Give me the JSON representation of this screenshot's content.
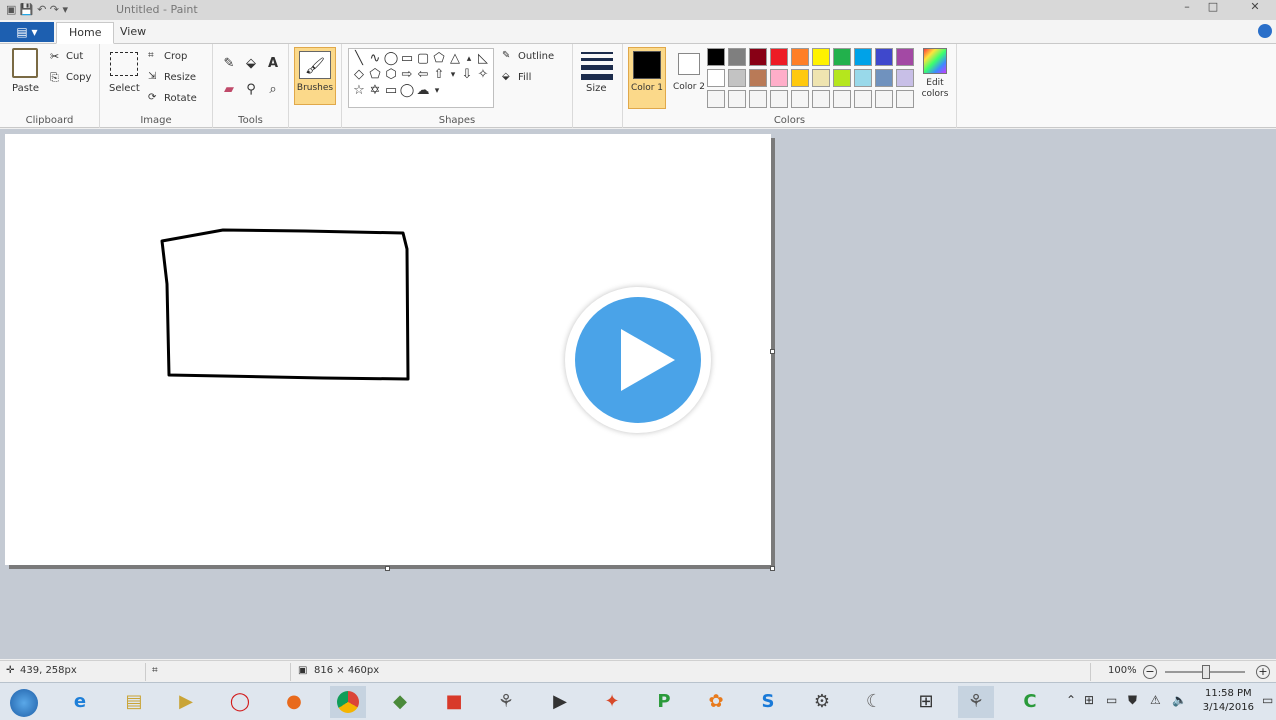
{
  "window": {
    "title": "Untitled - Paint",
    "controls": [
      "–",
      "□",
      "✕"
    ]
  },
  "tabs": {
    "file_label": "▤ ▾",
    "home": "Home",
    "view": "View"
  },
  "ribbon": {
    "clipboard": {
      "label": "Clipboard",
      "paste": "Paste",
      "cut": "Cut",
      "copy": "Copy"
    },
    "image": {
      "label": "Image",
      "select": "Select",
      "crop": "Crop",
      "resize": "Resize",
      "rotate": "Rotate"
    },
    "tools": {
      "label": "Tools"
    },
    "brushes": {
      "label": "Brushes"
    },
    "shapes": {
      "label": "Shapes",
      "outline": "Outline",
      "fill": "Fill"
    },
    "size": {
      "label": "Size"
    },
    "colors": {
      "label": "Colors",
      "color1": "Color 1",
      "color2": "Color 2",
      "edit": "Edit colors",
      "row1": [
        "#000000",
        "#7f7f7f",
        "#880015",
        "#ed1c24",
        "#ff7f27",
        "#fff200",
        "#22b14c",
        "#00a2e8",
        "#3f48cc",
        "#a349a4"
      ],
      "row2": [
        "#ffffff",
        "#c3c3c3",
        "#b97a57",
        "#ffaec9",
        "#ffc90e",
        "#efe4b0",
        "#b5e61d",
        "#99d9ea",
        "#7092be",
        "#c8bfe7"
      ],
      "row3": [
        "#f5f5f5",
        "#f5f5f5",
        "#f5f5f5",
        "#f5f5f5",
        "#f5f5f5",
        "#f5f5f5",
        "#f5f5f5",
        "#f5f5f5",
        "#f5f5f5",
        "#f5f5f5"
      ]
    }
  },
  "status": {
    "cursor": "439, 258px",
    "canvas_size": "816 × 460px",
    "zoom": "100%"
  },
  "taskbar": {
    "time": "11:58 PM",
    "date": "3/14/2016"
  }
}
